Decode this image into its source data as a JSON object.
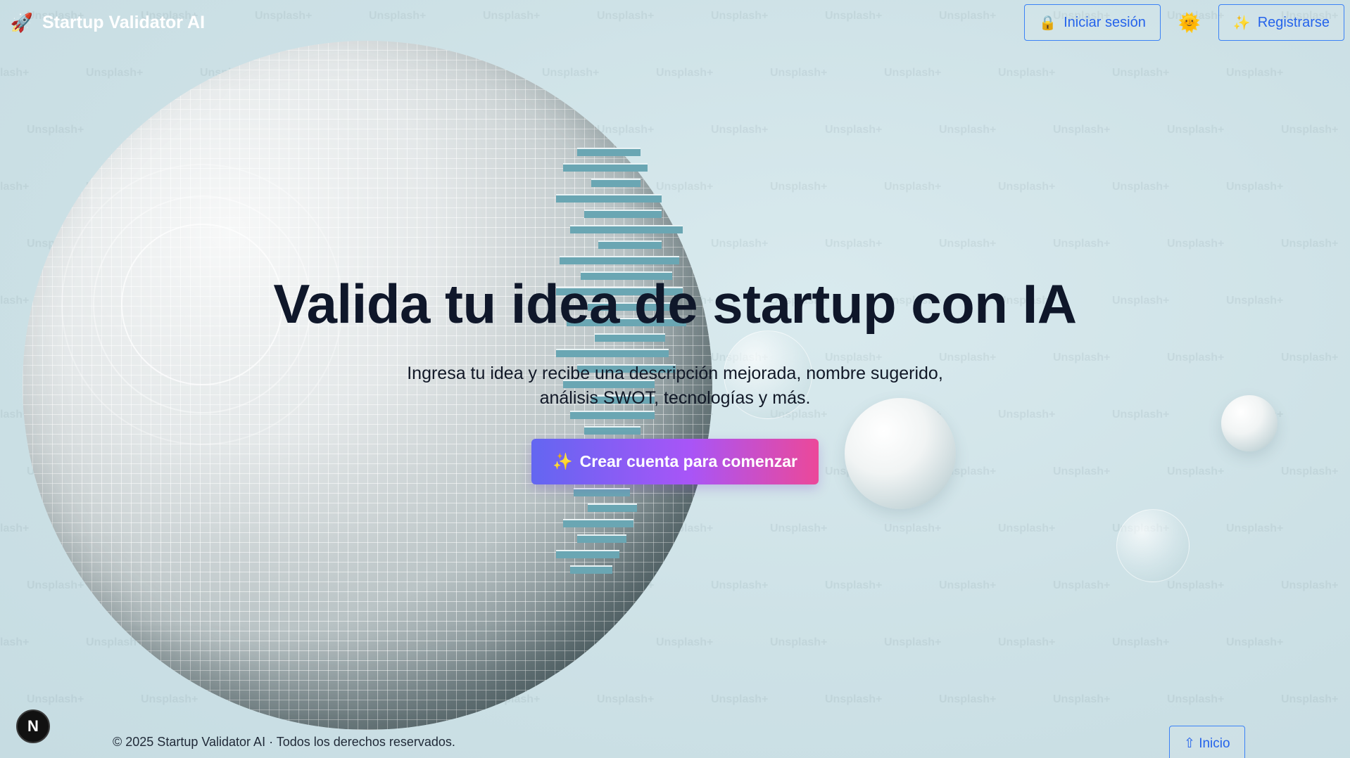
{
  "header": {
    "brand_icon": "🚀",
    "brand_title": "Startup Validator AI",
    "login_icon": "🔒",
    "login_label": "Iniciar sesión",
    "theme_icon": "🌞",
    "register_icon": "✨",
    "register_label": "Registrarse"
  },
  "hero": {
    "title": "Valida tu idea de startup con IA",
    "subtitle": "Ingresa tu idea y recibe una descripción mejorada, nombre sugerido, análisis SWOT, tecnologías y más.",
    "cta_icon": "✨",
    "cta_label": "Crear cuenta para comenzar"
  },
  "background": {
    "watermark_text": "Unsplash+"
  },
  "footer": {
    "copyright": "© 2025 Startup Validator AI · Todos los derechos reservados.",
    "back_to_top": "⇧ Inicio"
  },
  "dev_badge": "N",
  "colors": {
    "accent_blue": "#2563eb",
    "cta_gradient_start": "#6366f1",
    "cta_gradient_end": "#ec4899",
    "background": "#cfe3e8",
    "heading": "#0f172a"
  }
}
